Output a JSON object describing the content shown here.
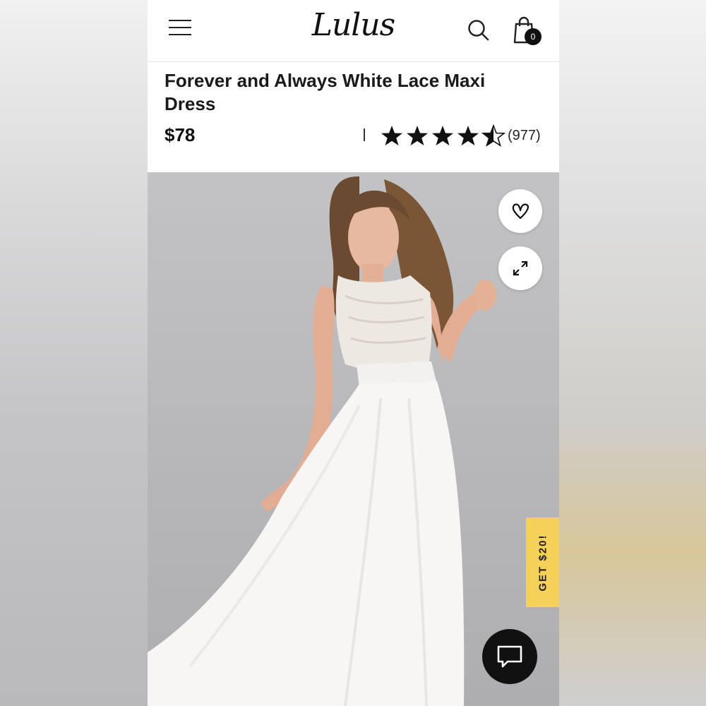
{
  "header": {
    "logo_text": "Lulus",
    "menu_icon": "hamburger-menu-icon",
    "search_icon": "search-icon",
    "bag_icon": "shopping-bag-icon",
    "bag_count": "0"
  },
  "product": {
    "title": "Forever and Always White Lace Maxi Dress",
    "price": "$78",
    "rating_value": 4.5,
    "rating_max": 5,
    "review_count": "(977)"
  },
  "gallery": {
    "favorite_icon": "heart-icon",
    "expand_icon": "expand-arrows-icon",
    "photo_description_icon": "product-photo"
  },
  "promo": {
    "label": "GET $20!",
    "color": "#f5d15a"
  },
  "chat": {
    "icon": "chat-bubble-icon"
  }
}
